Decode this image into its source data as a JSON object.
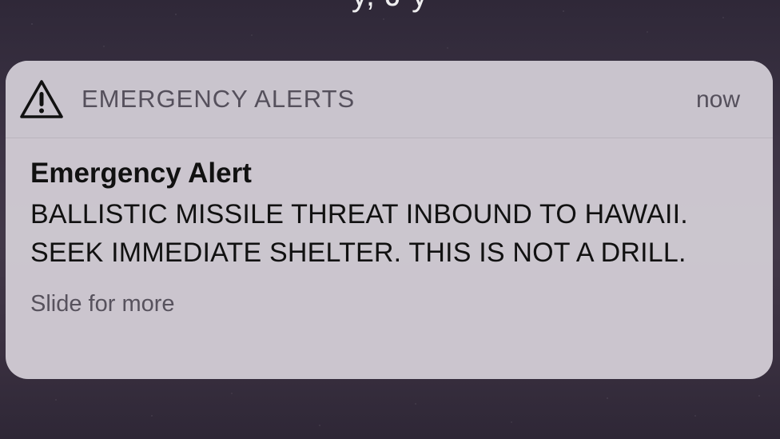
{
  "background": {
    "top_text": "y, J   y"
  },
  "notification": {
    "app_name": "EMERGENCY ALERTS",
    "time": "now",
    "title": "Emergency Alert",
    "message": "BALLISTIC MISSILE THREAT INBOUND TO HAWAII. SEEK IMMEDIATE SHELTER. THIS IS NOT A DRILL.",
    "footer": "Slide for more",
    "icon": "warning-triangle-icon"
  },
  "colors": {
    "card_background": "#d3ced6",
    "header_background": "#c9c4cd",
    "text_primary": "#111111",
    "text_secondary": "#55505c"
  }
}
